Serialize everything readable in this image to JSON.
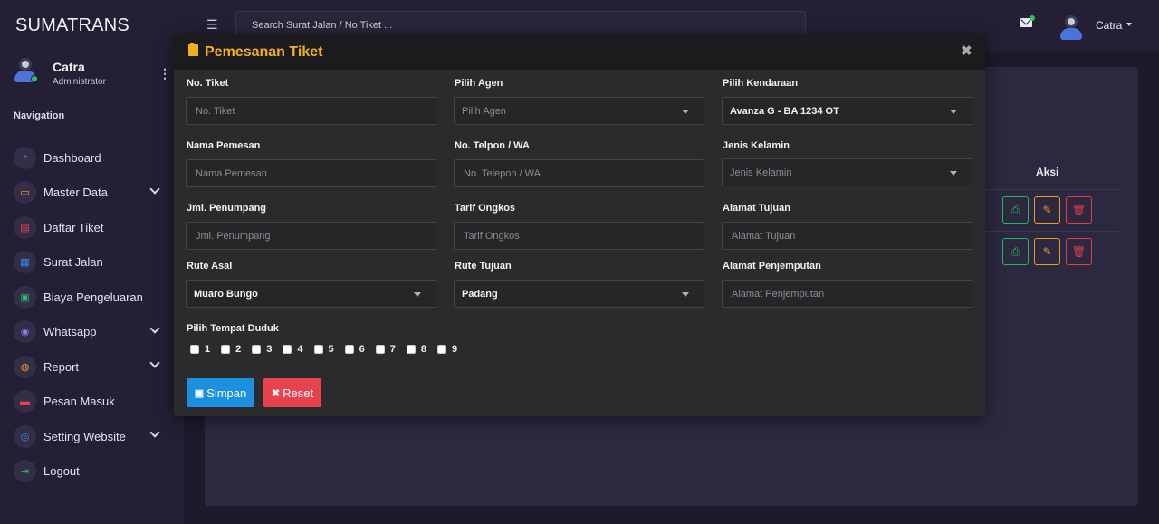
{
  "app": {
    "brand": "SUMATRANS"
  },
  "sidebar": {
    "user": {
      "name": "Catra",
      "role": "Administrator"
    },
    "nav_title": "Navigation",
    "items": [
      {
        "label": "Dashboard",
        "icon": "◔",
        "color": "#8e7cf0",
        "chevron": false
      },
      {
        "label": "Master Data",
        "icon": "▭",
        "color": "#f0a21d",
        "chevron": true
      },
      {
        "label": "Daftar Tiket",
        "icon": "▤",
        "color": "#e8424f",
        "chevron": false
      },
      {
        "label": "Surat Jalan",
        "icon": "▦",
        "color": "#3a8ef0",
        "chevron": false
      },
      {
        "label": "Biaya Pengeluaran",
        "icon": "▣",
        "color": "#2fbf62",
        "chevron": false
      },
      {
        "label": "Whatsapp",
        "icon": "◉",
        "color": "#8e7cf0",
        "chevron": true
      },
      {
        "label": "Report",
        "icon": "◍",
        "color": "#f0a21d",
        "chevron": true
      },
      {
        "label": "Pesan Masuk",
        "icon": "▬",
        "color": "#e8424f",
        "chevron": false
      },
      {
        "label": "Setting Website",
        "icon": "◎",
        "color": "#3a8ef0",
        "chevron": true
      },
      {
        "label": "Logout",
        "icon": "⇥",
        "color": "#2fbf62",
        "chevron": false
      }
    ]
  },
  "topbar": {
    "search_placeholder": "Search Surat Jalan / No Tiket ...",
    "user_name": "Catra"
  },
  "table": {
    "header_aksi": "Aksi"
  },
  "modal": {
    "title": "Pemesanan Tiket",
    "fields": {
      "no_tiket": {
        "label": "No. Tiket",
        "placeholder": "No. Tiket"
      },
      "pilih_agen": {
        "label": "Pilih Agen",
        "value": "Pilih Agen"
      },
      "pilih_kendaraan": {
        "label": "Pilih Kendaraan",
        "value": "Avanza G - BA 1234 OT"
      },
      "nama_pemesan": {
        "label": "Nama Pemesan",
        "placeholder": "Nama Pemesan"
      },
      "no_telpon": {
        "label": "No. Telpon / WA",
        "placeholder": "No. Telepon / WA"
      },
      "jenis_kelamin": {
        "label": "Jenis Kelamin",
        "value": "Jenis Kelamin"
      },
      "jml_penumpang": {
        "label": "Jml. Penumpang",
        "placeholder": "Jml. Penumpang"
      },
      "tarif_ongkos": {
        "label": "Tarif Ongkos",
        "placeholder": "Tarif Ongkos"
      },
      "alamat_tujuan": {
        "label": "Alamat Tujuan",
        "placeholder": "Alamat Tujuan"
      },
      "rute_asal": {
        "label": "Rute Asal",
        "value": "Muaro Bungo"
      },
      "rute_tujuan": {
        "label": "Rute Tujuan",
        "value": "Padang"
      },
      "alamat_penjemputan": {
        "label": "Alamat Penjemputan",
        "placeholder": "Alamat Penjemputan"
      }
    },
    "seat_label": "Pilih Tempat Duduk",
    "seats": [
      "1",
      "2",
      "3",
      "4",
      "5",
      "6",
      "7",
      "8",
      "9"
    ],
    "buttons": {
      "save": "Simpan",
      "reset": "Reset"
    }
  },
  "colors": {
    "accent_title": "#f2b01c",
    "save_button": "#1b8fe0",
    "reset_button": "#e8424f",
    "online": "#33c25a"
  }
}
